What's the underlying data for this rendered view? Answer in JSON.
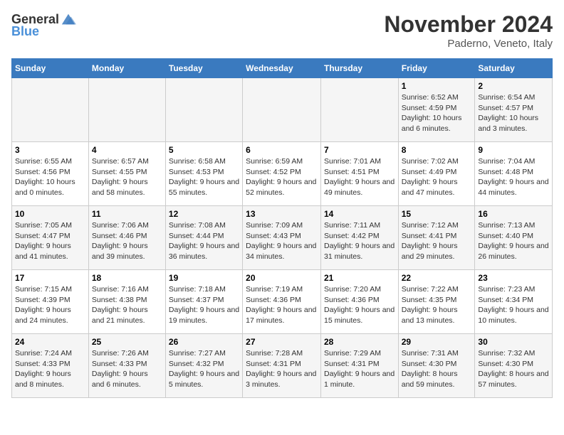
{
  "logo": {
    "text_general": "General",
    "text_blue": "Blue"
  },
  "header": {
    "title": "November 2024",
    "location": "Paderno, Veneto, Italy"
  },
  "columns": [
    "Sunday",
    "Monday",
    "Tuesday",
    "Wednesday",
    "Thursday",
    "Friday",
    "Saturday"
  ],
  "weeks": [
    [
      {
        "day": "",
        "info": ""
      },
      {
        "day": "",
        "info": ""
      },
      {
        "day": "",
        "info": ""
      },
      {
        "day": "",
        "info": ""
      },
      {
        "day": "",
        "info": ""
      },
      {
        "day": "1",
        "info": "Sunrise: 6:52 AM\nSunset: 4:59 PM\nDaylight: 10 hours and 6 minutes."
      },
      {
        "day": "2",
        "info": "Sunrise: 6:54 AM\nSunset: 4:57 PM\nDaylight: 10 hours and 3 minutes."
      }
    ],
    [
      {
        "day": "3",
        "info": "Sunrise: 6:55 AM\nSunset: 4:56 PM\nDaylight: 10 hours and 0 minutes."
      },
      {
        "day": "4",
        "info": "Sunrise: 6:57 AM\nSunset: 4:55 PM\nDaylight: 9 hours and 58 minutes."
      },
      {
        "day": "5",
        "info": "Sunrise: 6:58 AM\nSunset: 4:53 PM\nDaylight: 9 hours and 55 minutes."
      },
      {
        "day": "6",
        "info": "Sunrise: 6:59 AM\nSunset: 4:52 PM\nDaylight: 9 hours and 52 minutes."
      },
      {
        "day": "7",
        "info": "Sunrise: 7:01 AM\nSunset: 4:51 PM\nDaylight: 9 hours and 49 minutes."
      },
      {
        "day": "8",
        "info": "Sunrise: 7:02 AM\nSunset: 4:49 PM\nDaylight: 9 hours and 47 minutes."
      },
      {
        "day": "9",
        "info": "Sunrise: 7:04 AM\nSunset: 4:48 PM\nDaylight: 9 hours and 44 minutes."
      }
    ],
    [
      {
        "day": "10",
        "info": "Sunrise: 7:05 AM\nSunset: 4:47 PM\nDaylight: 9 hours and 41 minutes."
      },
      {
        "day": "11",
        "info": "Sunrise: 7:06 AM\nSunset: 4:46 PM\nDaylight: 9 hours and 39 minutes."
      },
      {
        "day": "12",
        "info": "Sunrise: 7:08 AM\nSunset: 4:44 PM\nDaylight: 9 hours and 36 minutes."
      },
      {
        "day": "13",
        "info": "Sunrise: 7:09 AM\nSunset: 4:43 PM\nDaylight: 9 hours and 34 minutes."
      },
      {
        "day": "14",
        "info": "Sunrise: 7:11 AM\nSunset: 4:42 PM\nDaylight: 9 hours and 31 minutes."
      },
      {
        "day": "15",
        "info": "Sunrise: 7:12 AM\nSunset: 4:41 PM\nDaylight: 9 hours and 29 minutes."
      },
      {
        "day": "16",
        "info": "Sunrise: 7:13 AM\nSunset: 4:40 PM\nDaylight: 9 hours and 26 minutes."
      }
    ],
    [
      {
        "day": "17",
        "info": "Sunrise: 7:15 AM\nSunset: 4:39 PM\nDaylight: 9 hours and 24 minutes."
      },
      {
        "day": "18",
        "info": "Sunrise: 7:16 AM\nSunset: 4:38 PM\nDaylight: 9 hours and 21 minutes."
      },
      {
        "day": "19",
        "info": "Sunrise: 7:18 AM\nSunset: 4:37 PM\nDaylight: 9 hours and 19 minutes."
      },
      {
        "day": "20",
        "info": "Sunrise: 7:19 AM\nSunset: 4:36 PM\nDaylight: 9 hours and 17 minutes."
      },
      {
        "day": "21",
        "info": "Sunrise: 7:20 AM\nSunset: 4:36 PM\nDaylight: 9 hours and 15 minutes."
      },
      {
        "day": "22",
        "info": "Sunrise: 7:22 AM\nSunset: 4:35 PM\nDaylight: 9 hours and 13 minutes."
      },
      {
        "day": "23",
        "info": "Sunrise: 7:23 AM\nSunset: 4:34 PM\nDaylight: 9 hours and 10 minutes."
      }
    ],
    [
      {
        "day": "24",
        "info": "Sunrise: 7:24 AM\nSunset: 4:33 PM\nDaylight: 9 hours and 8 minutes."
      },
      {
        "day": "25",
        "info": "Sunrise: 7:26 AM\nSunset: 4:33 PM\nDaylight: 9 hours and 6 minutes."
      },
      {
        "day": "26",
        "info": "Sunrise: 7:27 AM\nSunset: 4:32 PM\nDaylight: 9 hours and 5 minutes."
      },
      {
        "day": "27",
        "info": "Sunrise: 7:28 AM\nSunset: 4:31 PM\nDaylight: 9 hours and 3 minutes."
      },
      {
        "day": "28",
        "info": "Sunrise: 7:29 AM\nSunset: 4:31 PM\nDaylight: 9 hours and 1 minute."
      },
      {
        "day": "29",
        "info": "Sunrise: 7:31 AM\nSunset: 4:30 PM\nDaylight: 8 hours and 59 minutes."
      },
      {
        "day": "30",
        "info": "Sunrise: 7:32 AM\nSunset: 4:30 PM\nDaylight: 8 hours and 57 minutes."
      }
    ]
  ]
}
